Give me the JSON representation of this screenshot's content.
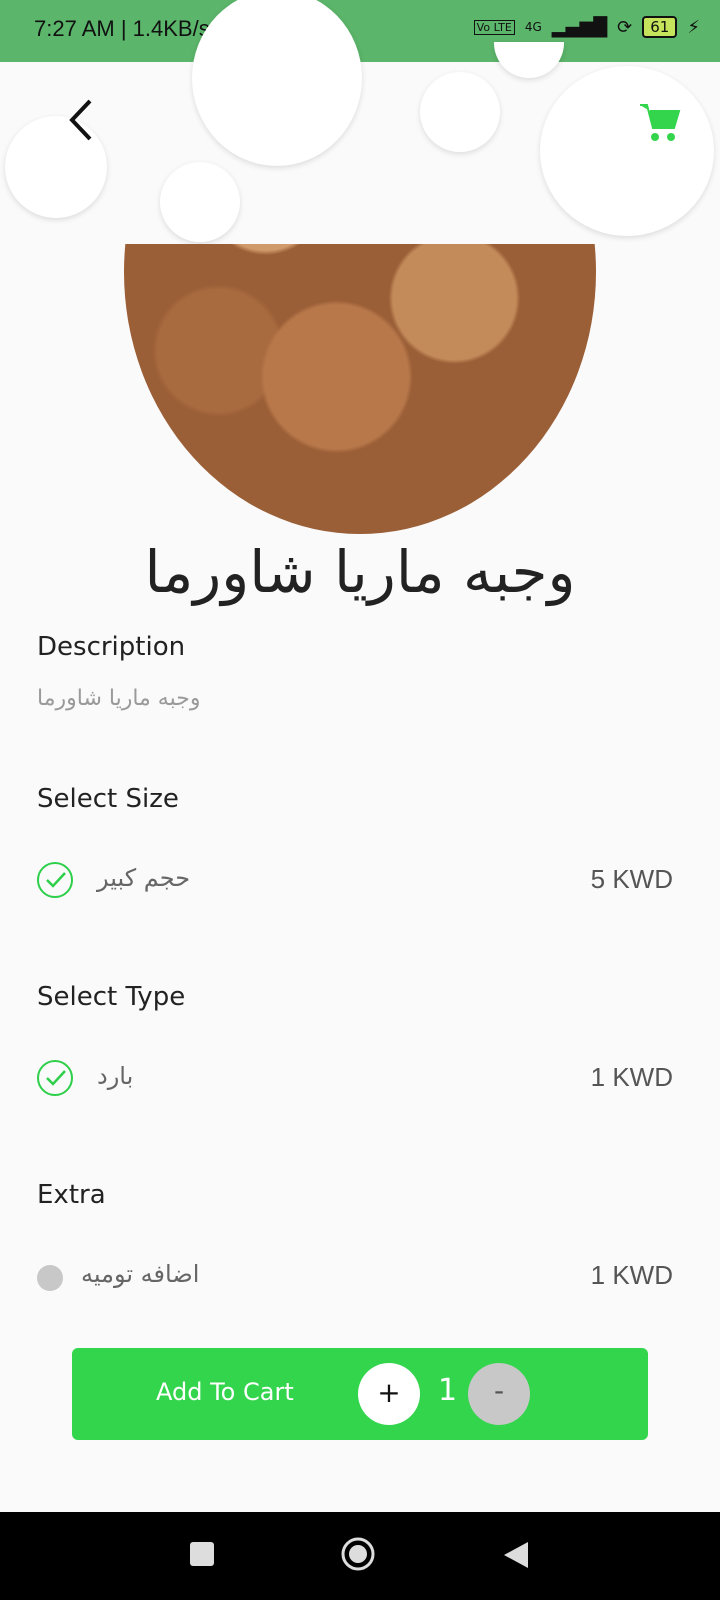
{
  "status_bar": {
    "time": "7:27 AM | 1.4KB/s",
    "network": "4G",
    "volte": "Vo LTE",
    "battery": "61"
  },
  "header": {
    "back_icon": "chevron-left-icon",
    "cart_icon": "cart-icon",
    "accent": "#33d54d"
  },
  "product": {
    "title": "وجبه ماريا شاورما",
    "image": "shawarma-photo"
  },
  "description": {
    "label": "Description",
    "text": "وجبه ماريا شاورما"
  },
  "size": {
    "label": "Select Size",
    "option": "حجم كبير",
    "price": "5 KWD",
    "selected": true
  },
  "type": {
    "label": "Select Type",
    "option": "بارد",
    "price": "1 KWD",
    "selected": true
  },
  "extra": {
    "label": "Extra",
    "option": "اضافه توميه",
    "price": "1 KWD",
    "selected": false
  },
  "cart_bar": {
    "add_label": "Add To Cart",
    "plus": "+",
    "quantity": "1",
    "minus": "-"
  }
}
